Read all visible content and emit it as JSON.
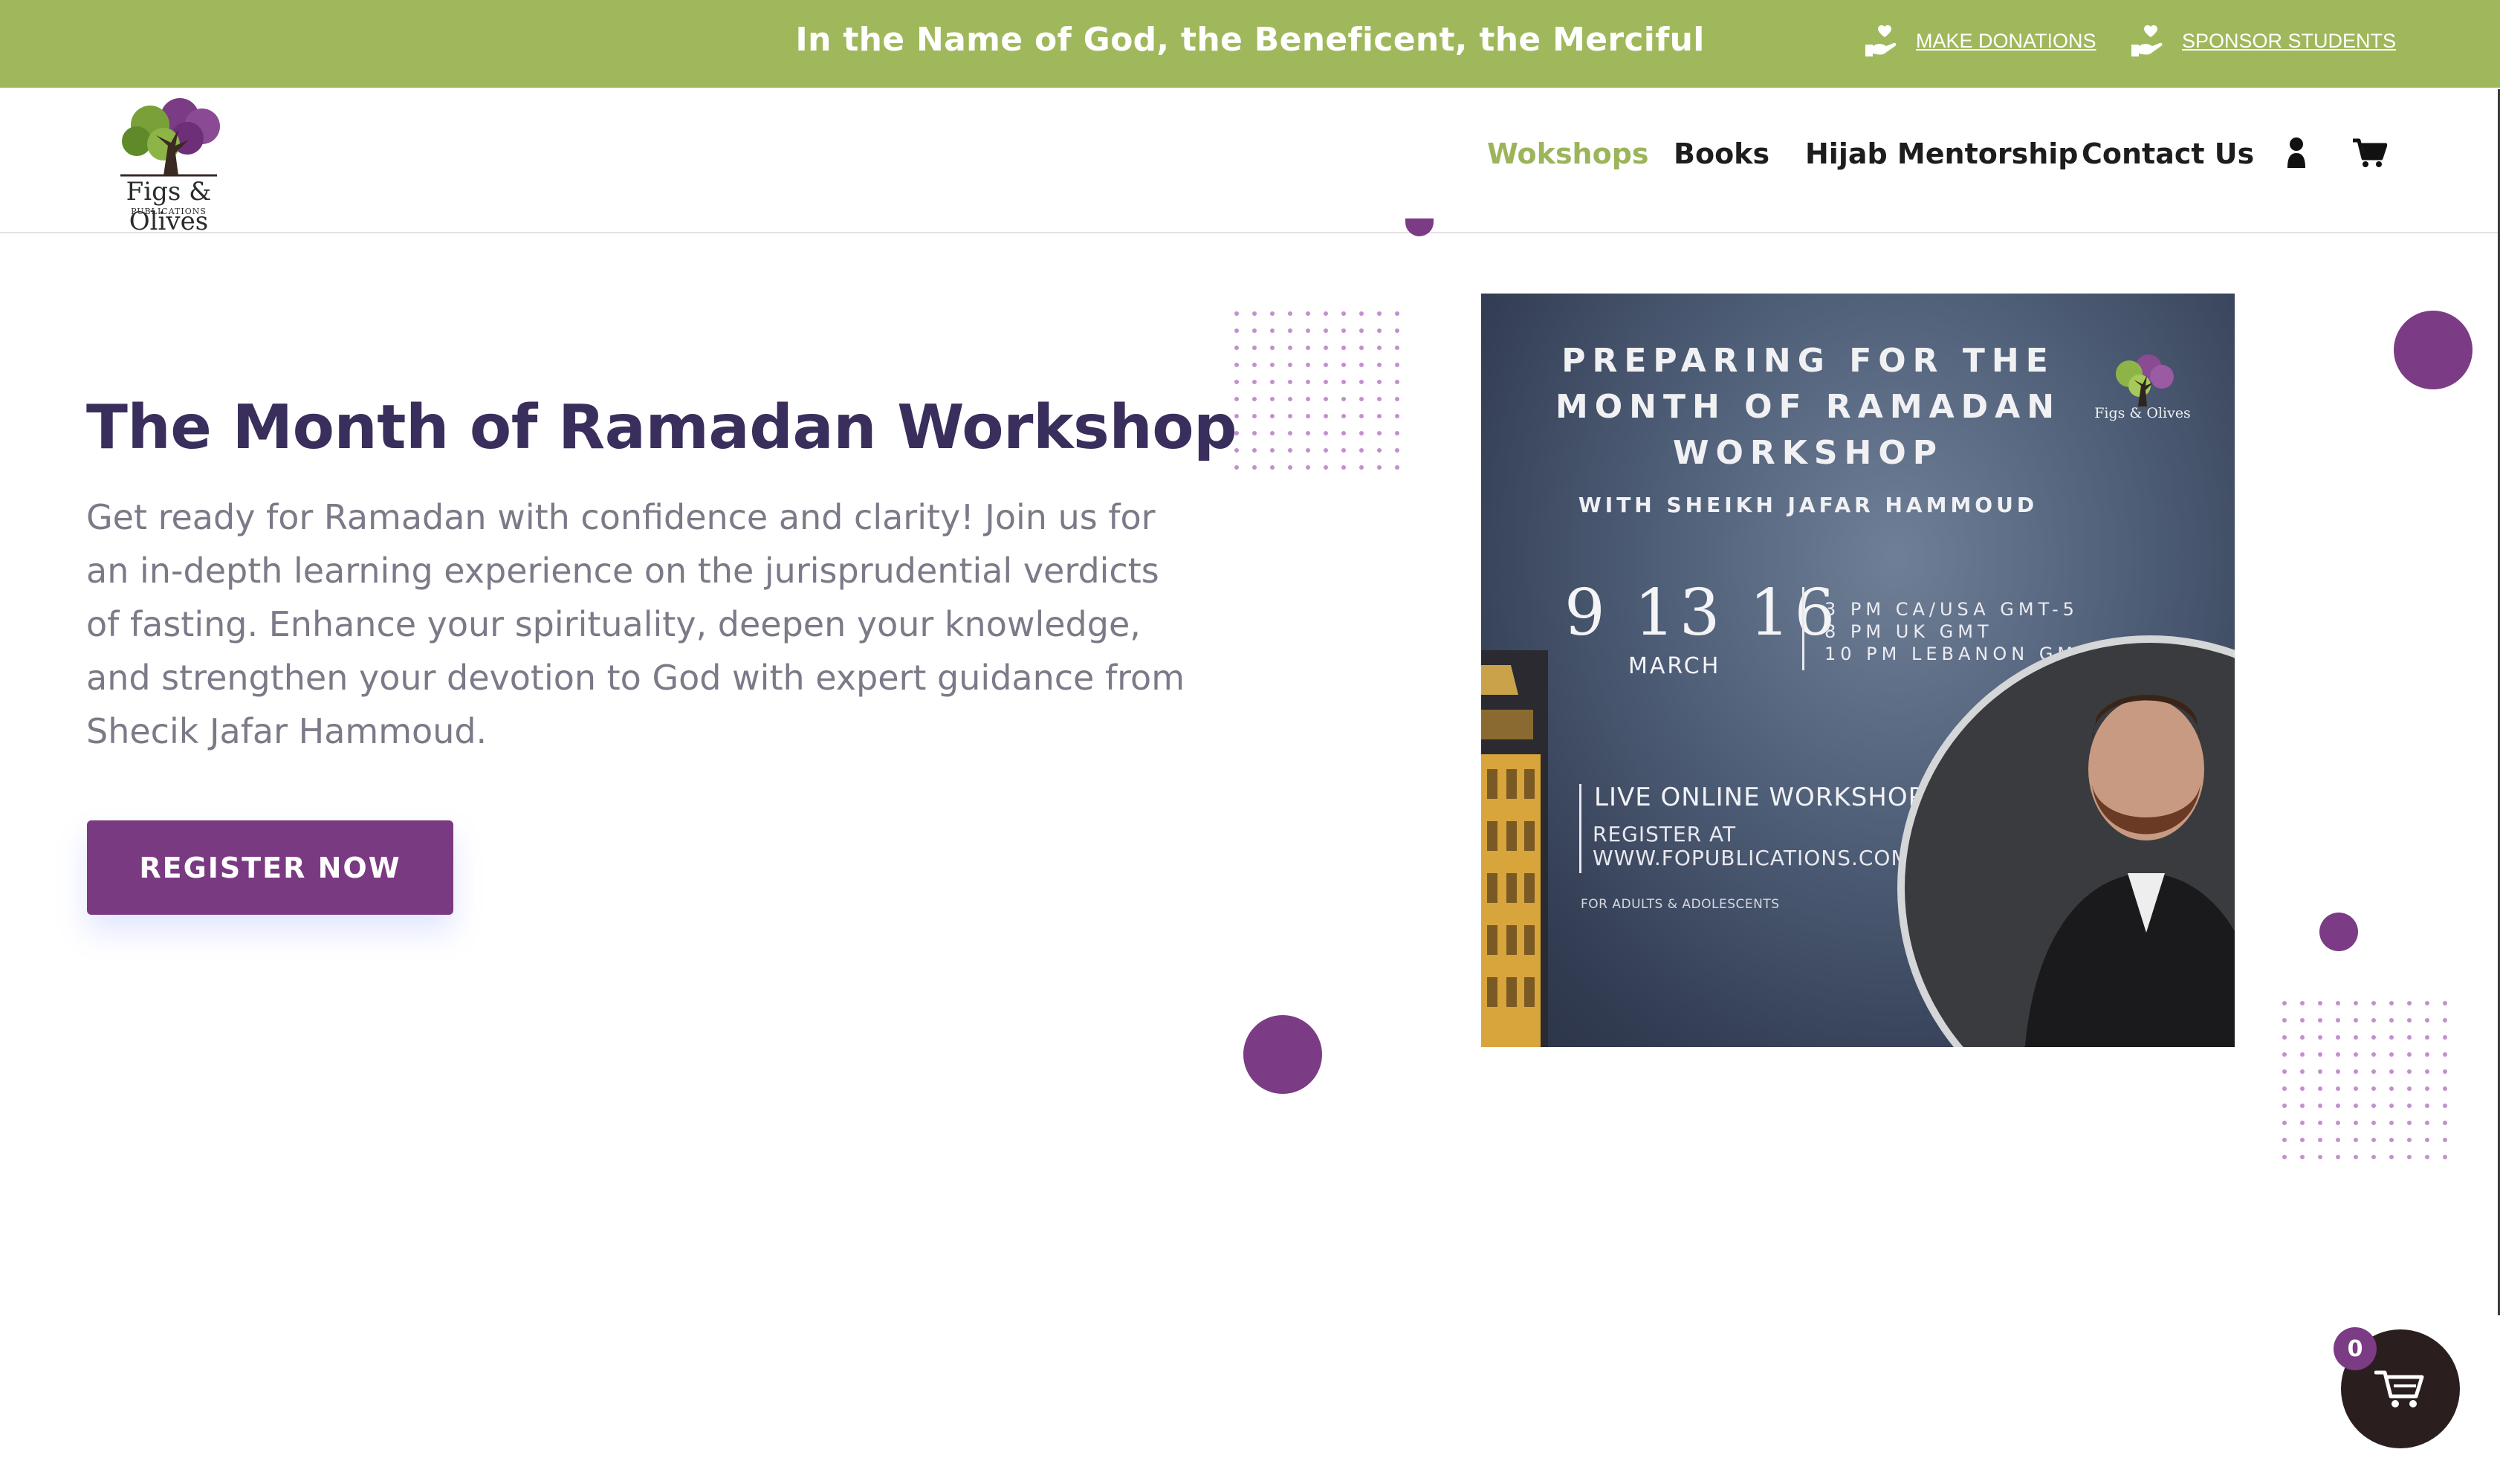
{
  "topbar": {
    "text": "In the Name of God, the Beneficent, the Merciful",
    "links": [
      {
        "label": "MAKE DONATIONS",
        "icon": "hand-heart-icon"
      },
      {
        "label": "SPONSOR STUDENTS",
        "icon": "hand-heart-icon"
      }
    ],
    "background": "#a0b85c"
  },
  "logo": {
    "name": "Figs & Olives",
    "sub": "PUBLICATIONS"
  },
  "nav": {
    "items": [
      {
        "label": "Wokshops",
        "active": true
      },
      {
        "label": "Books",
        "active": false
      },
      {
        "label": "Hijab Mentorship",
        "active": false
      },
      {
        "label": "Contact Us",
        "active": false
      }
    ],
    "icons": [
      "user-icon",
      "cart-icon"
    ],
    "active_color": "#9cb45a"
  },
  "hero": {
    "title": "The Month of Ramadan Workshop",
    "description": "Get ready for Ramadan with confidence and clarity! Join us for an in-depth learning experience on the jurisprudential verdicts of fasting. Enhance your spirituality, deepen your knowledge, and strengthen your devotion to God with expert guidance from Shecik Jafar Hammoud.",
    "button": "REGISTER NOW",
    "title_color": "#3a2e5c",
    "accent": "#7a3a82"
  },
  "poster": {
    "title": "PREPARING FOR THE MONTH OF RAMADAN WORKSHOP",
    "title_lines": [
      "PREPARING FOR THE",
      "MONTH OF RAMADAN",
      "WORKSHOP"
    ],
    "with": "WITH SHEIKH JAFAR HAMMOUD",
    "dates": "9 13 16",
    "month": "MARCH",
    "times": [
      "3 PM CA/USA GMT-5",
      "8 PM UK GMT",
      "10 PM LEBANON GMT+2"
    ],
    "live": "LIVE ONLINE WORKSHOP",
    "register_lines": [
      "REGISTER AT",
      "WWW.FOPUBLICATIONS.COM"
    ],
    "audience": "FOR ADULTS & ADOLESCENTS",
    "logo_text": "Figs & Olives"
  },
  "floating_cart": {
    "count": "0",
    "icon": "cart-icon"
  }
}
